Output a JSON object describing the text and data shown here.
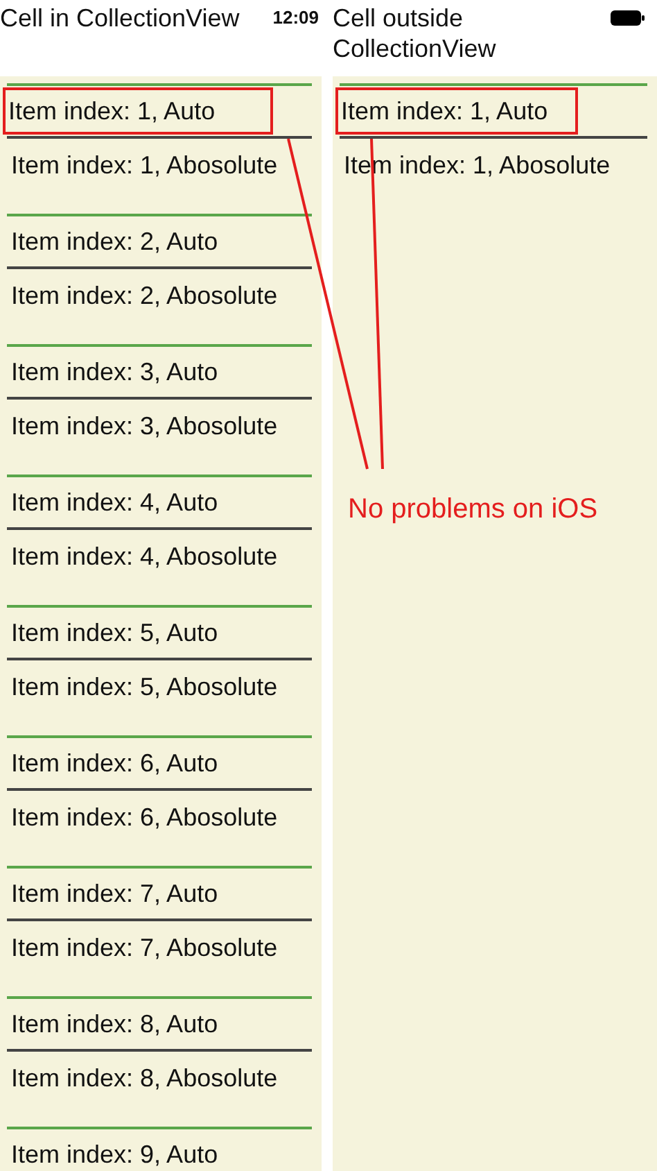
{
  "status_bar": {
    "time": "12:09"
  },
  "columns": [
    {
      "title": "Cell in CollectionView",
      "cells": [
        {
          "rows": [
            {
              "text": "Item index: 1, Auto",
              "highlighted": true
            },
            {
              "text": "Item index: 1, Abosolute",
              "highlighted": false
            }
          ]
        },
        {
          "rows": [
            {
              "text": "Item index: 2, Auto",
              "highlighted": false
            },
            {
              "text": "Item index: 2, Abosolute",
              "highlighted": false
            }
          ]
        },
        {
          "rows": [
            {
              "text": "Item index: 3, Auto",
              "highlighted": false
            },
            {
              "text": "Item index: 3, Abosolute",
              "highlighted": false
            }
          ]
        },
        {
          "rows": [
            {
              "text": "Item index: 4, Auto",
              "highlighted": false
            },
            {
              "text": "Item index: 4, Abosolute",
              "highlighted": false
            }
          ]
        },
        {
          "rows": [
            {
              "text": "Item index: 5, Auto",
              "highlighted": false
            },
            {
              "text": "Item index: 5, Abosolute",
              "highlighted": false
            }
          ]
        },
        {
          "rows": [
            {
              "text": "Item index: 6, Auto",
              "highlighted": false
            },
            {
              "text": "Item index: 6, Abosolute",
              "highlighted": false
            }
          ]
        },
        {
          "rows": [
            {
              "text": "Item index: 7, Auto",
              "highlighted": false
            },
            {
              "text": "Item index: 7, Abosolute",
              "highlighted": false
            }
          ]
        },
        {
          "rows": [
            {
              "text": "Item index: 8, Auto",
              "highlighted": false
            },
            {
              "text": "Item index: 8, Abosolute",
              "highlighted": false
            }
          ]
        },
        {
          "rows": [
            {
              "text": "Item index: 9, Auto",
              "highlighted": false
            }
          ]
        }
      ]
    },
    {
      "title": "Cell outside CollectionView",
      "cells": [
        {
          "rows": [
            {
              "text": "Item index: 1, Auto",
              "highlighted": true
            },
            {
              "text": "Item index: 1, Abosolute",
              "highlighted": false
            }
          ]
        }
      ]
    }
  ],
  "annotation": {
    "text": "No problems on iOS"
  }
}
